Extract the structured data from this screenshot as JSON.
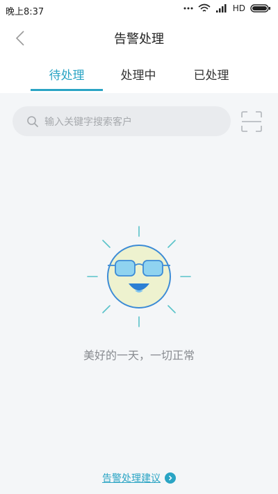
{
  "status_bar": {
    "time": "晚上8:37",
    "network": "HD",
    "icons": [
      "dots-icon",
      "wifi-icon",
      "signal-icon",
      "battery-icon"
    ]
  },
  "header": {
    "title": "告警处理",
    "back_icon": "chevron-left-icon"
  },
  "tabs": [
    {
      "label": "待处理",
      "active": true
    },
    {
      "label": "处理中",
      "active": false
    },
    {
      "label": "已处理",
      "active": false
    }
  ],
  "search": {
    "placeholder": "输入关键字搜索客户",
    "icon": "search-icon",
    "scan_icon": "scan-icon"
  },
  "empty_state": {
    "illustration": "sun-sunglasses-icon",
    "message": "美好的一天，一切正常"
  },
  "footer": {
    "link_label": "告警处理建议",
    "arrow_icon": "chevron-right-circle-icon"
  },
  "colors": {
    "accent": "#2aa4c4",
    "background": "#f4f6f8",
    "search_bg": "#e9ebee"
  }
}
